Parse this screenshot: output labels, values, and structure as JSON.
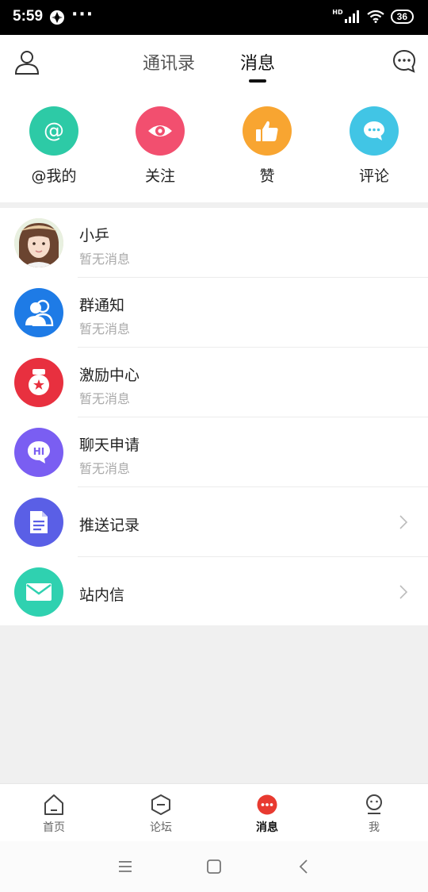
{
  "status_bar": {
    "time": "5:59",
    "more": "···",
    "net": "HD",
    "battery": "36"
  },
  "header": {
    "tabs": [
      {
        "label": "通讯录",
        "active": false
      },
      {
        "label": "消息",
        "active": true
      }
    ]
  },
  "quick_actions": [
    {
      "label": "@我的",
      "icon": "at-icon",
      "color": "#2dcaa6"
    },
    {
      "label": "关注",
      "icon": "eye-icon",
      "color": "#f24f6f"
    },
    {
      "label": "赞",
      "icon": "thumbs-up-icon",
      "color": "#f8a531"
    },
    {
      "label": "评论",
      "icon": "comment-icon",
      "color": "#41c5e5"
    }
  ],
  "messages": [
    {
      "title": "小乒",
      "subtitle": "暂无消息",
      "icon": "user-photo"
    },
    {
      "title": "群通知",
      "subtitle": "暂无消息",
      "icon": "group-icon",
      "color": "#1e7be6"
    },
    {
      "title": "激励中心",
      "subtitle": "暂无消息",
      "icon": "medal-icon",
      "color": "#e8303f"
    },
    {
      "title": "聊天申请",
      "subtitle": "暂无消息",
      "icon": "hi-chat-icon",
      "color": "#7a5ef2"
    },
    {
      "title": "推送记录",
      "icon": "document-icon",
      "color": "#5a5fe6"
    },
    {
      "title": "站内信",
      "icon": "mail-icon",
      "color": "#2fd1b0"
    }
  ],
  "bottom_nav": [
    {
      "label": "首页",
      "icon": "home-icon",
      "active": false
    },
    {
      "label": "论坛",
      "icon": "forum-icon",
      "active": false
    },
    {
      "label": "消息",
      "icon": "messages-icon",
      "active": true
    },
    {
      "label": "我",
      "icon": "me-icon",
      "active": false
    }
  ],
  "colors": {
    "accent": "#e83a30",
    "text": "#222222",
    "muted": "#aaaaaa"
  }
}
